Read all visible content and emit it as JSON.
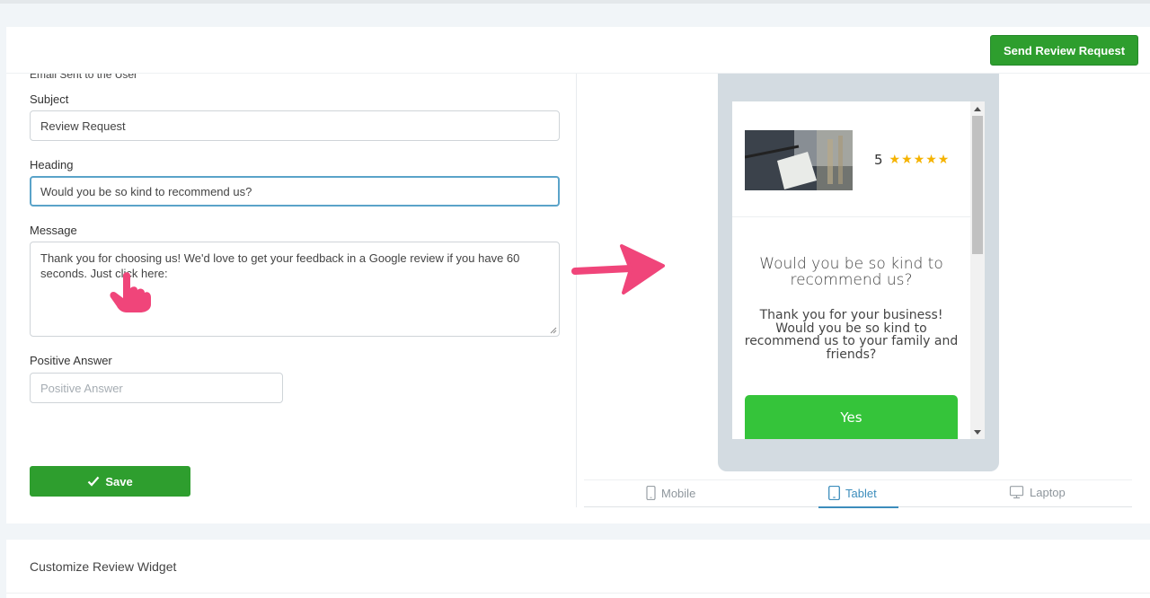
{
  "header": {
    "send_button_label": "Send Review Request"
  },
  "form": {
    "section_title": "Email Sent to the User",
    "subject_label": "Subject",
    "subject_value": "Review Request",
    "heading_label": "Heading",
    "heading_value": "Would you be so kind to recommend us?",
    "message_label": "Message",
    "message_value": "Thank you for choosing us! We'd love to get your feedback in a Google review if you have 60 seconds. Just click here:",
    "positive_label": "Positive Answer",
    "positive_placeholder": "Positive Answer",
    "save_label": "Save"
  },
  "preview": {
    "rating": "5",
    "star_count": 5,
    "heading": "Would you be so kind to recommend us?",
    "message": "Thank you for your business! Would you be so kind to recommend us to your family and friends?",
    "yes_label": "Yes"
  },
  "device_tabs": [
    {
      "label": "Mobile",
      "icon": "phone-icon",
      "active": false
    },
    {
      "label": "Tablet",
      "icon": "tablet-icon",
      "active": true
    },
    {
      "label": "Laptop",
      "icon": "laptop-icon",
      "active": false
    }
  ],
  "bottom_section": {
    "title": "Customize Review Widget"
  },
  "colors": {
    "primary_green": "#2e9e2e",
    "yes_green": "#35c43a",
    "accent_blue": "#3c8dbc",
    "star_yellow": "#f5b301",
    "annotation_pink": "#f0457a"
  }
}
